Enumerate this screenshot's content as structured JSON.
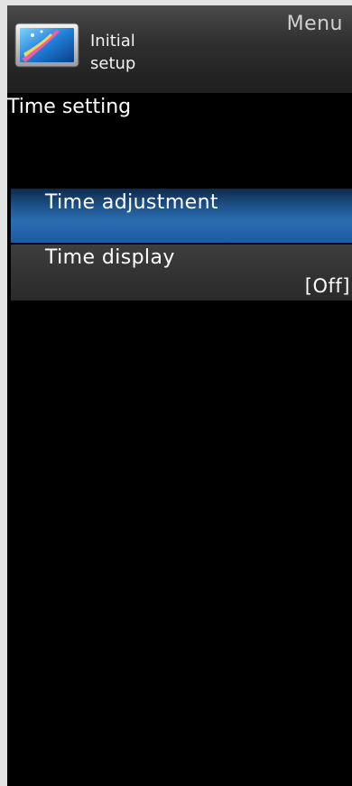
{
  "header": {
    "menu_title": "Menu",
    "label_line1": "Initial",
    "label_line2": "setup",
    "icon": "tv-setup-icon"
  },
  "section_title": "Time setting",
  "menu": {
    "items": [
      {
        "label": "Time adjustment",
        "value": "",
        "selected": true
      },
      {
        "label": "Time display",
        "value": "[Off]",
        "selected": false
      }
    ]
  },
  "colors": {
    "background": "#000000",
    "selected_item": "#2a6db3",
    "normal_item": "#333333",
    "frame": "#e3e3e3"
  }
}
